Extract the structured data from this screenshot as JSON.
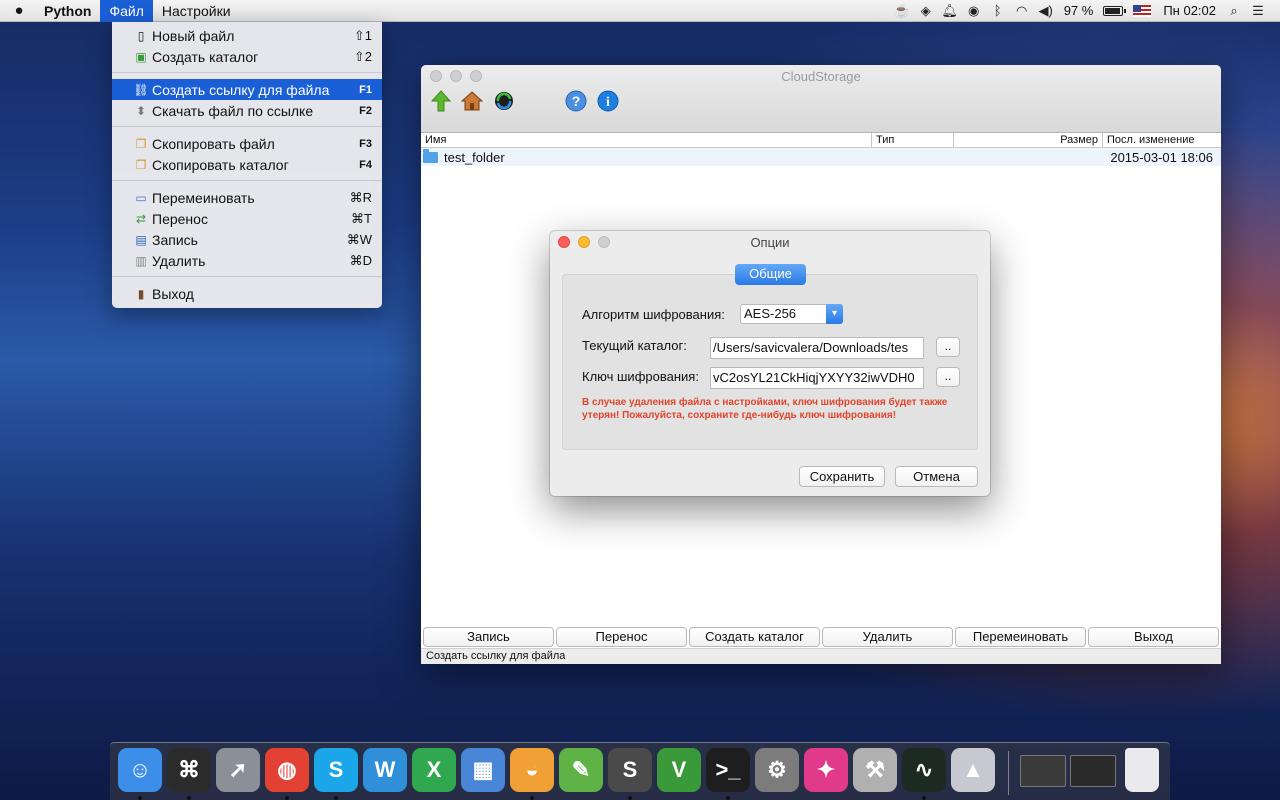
{
  "menubar": {
    "app_name": "Python",
    "menu_file": "Файл",
    "menu_settings": "Настройки",
    "battery_text": "97 %",
    "battery_level": 0.97,
    "clock": "Пн 02:02"
  },
  "file_menu": {
    "new_file": {
      "label": "Новый файл",
      "shortcut": "⇧1"
    },
    "create_dir": {
      "label": "Создать каталог",
      "shortcut": "⇧2"
    },
    "create_link": {
      "label": "Создать ссылку для файла",
      "shortcut": "F1"
    },
    "download_link": {
      "label": "Скачать файл по ссылке",
      "shortcut": "F2"
    },
    "copy_file": {
      "label": "Скопировать файл",
      "shortcut": "F3"
    },
    "copy_dir": {
      "label": "Скопировать каталог",
      "shortcut": "F4"
    },
    "rename": {
      "label": "Перемеиновать",
      "shortcut": "⌘R"
    },
    "move": {
      "label": "Перенос",
      "shortcut": "⌘T"
    },
    "write": {
      "label": "Запись",
      "shortcut": "⌘W"
    },
    "delete": {
      "label": "Удалить",
      "shortcut": "⌘D"
    },
    "exit": {
      "label": "Выход"
    }
  },
  "window": {
    "title": "CloudStorage",
    "columns": {
      "name": "Имя",
      "type": "Тип",
      "size": "Размер",
      "modified": "Посл. изменение"
    },
    "files": [
      {
        "name": "test_folder",
        "type": "",
        "size": "",
        "modified": "2015-03-01 18:06"
      }
    ],
    "buttons": {
      "write": "Запись",
      "move": "Перенос",
      "create_dir": "Создать каталог",
      "delete": "Удалить",
      "rename": "Перемеиновать",
      "exit": "Выход"
    },
    "status": "Создать ссылку для файла"
  },
  "dialog": {
    "title": "Опции",
    "tab": "Общие",
    "algorithm_label": "Алгоритм шифрования:",
    "algorithm_value": "AES-256",
    "dir_label": "Текущий каталог:",
    "dir_value": "/Users/savicvalera/Downloads/tes",
    "key_label": "Ключ шифрования:",
    "key_value": "vC2osYL21CkHiqjYXYY32iwVDH0",
    "browse": "..",
    "warning": "В случае удаления файла с настройками, ключ шифрования будет также утерян! Пожалуйста, сохраните где-нибудь ключ шифрования!",
    "save": "Сохранить",
    "cancel": "Отмена"
  },
  "dock": {
    "apps": [
      {
        "icon": "finder-icon",
        "color": "#3d8ee8"
      },
      {
        "icon": "alfred-icon",
        "color": "#2b2b2b"
      },
      {
        "icon": "launchpad-icon",
        "color": "#8a8f98"
      },
      {
        "icon": "chrome-icon",
        "color": "#e34133"
      },
      {
        "icon": "skype-icon",
        "color": "#1aa6e8"
      },
      {
        "icon": "word-icon",
        "color": "#2f8fd8"
      },
      {
        "icon": "excel-icon",
        "color": "#2fa84f"
      },
      {
        "icon": "keynote-icon",
        "color": "#4a86d8"
      },
      {
        "icon": "pycharm-icon",
        "color": "#f0a035"
      },
      {
        "icon": "git-icon",
        "color": "#5fb246"
      },
      {
        "icon": "sublime-icon",
        "color": "#4a4a4a"
      },
      {
        "icon": "vim-icon",
        "color": "#3a9a3a"
      },
      {
        "icon": "terminal-icon",
        "color": "#1e1e1e"
      },
      {
        "icon": "preferences-icon",
        "color": "#7c7c7c"
      },
      {
        "icon": "mosquito-icon",
        "color": "#e23a8a"
      },
      {
        "icon": "scripts-icon",
        "color": "#b0b0b0"
      },
      {
        "icon": "activity-monitor-icon",
        "color": "#1c2a22"
      },
      {
        "icon": "rocket-icon",
        "color": "#c8c8d0"
      }
    ]
  }
}
